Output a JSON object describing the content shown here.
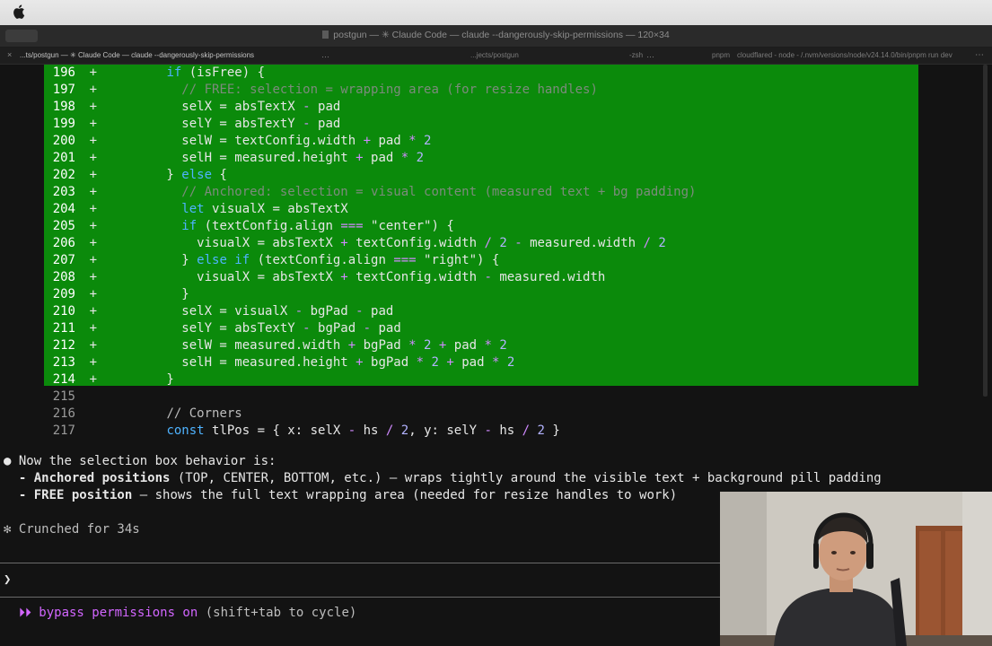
{
  "window": {
    "title": "postgun — ✳ Claude Code — claude --dangerously-skip-permissions — 120×34",
    "button_label": "⌘"
  },
  "tabs": [
    {
      "label": "...ts/postgun — ✳ Claude Code — claude --dangerously-skip-permissions"
    },
    {
      "label": "...jects/postgun"
    },
    {
      "label": "-zsh"
    },
    {
      "label": "pnpm"
    },
    {
      "label": "cloudflared - node - /.nvm/versions/node/v24.14.0/bin/pnpm run dev"
    }
  ],
  "diff": [
    {
      "num": "196",
      "marker": "+",
      "segs": [
        [
          "        ",
          ""
        ],
        [
          "if",
          "k"
        ],
        [
          " (isFree) {",
          ""
        ]
      ]
    },
    {
      "num": "197",
      "marker": "+",
      "segs": [
        [
          "          ",
          ""
        ],
        [
          "// FREE: selection = wrapping area (for resize handles)",
          "c"
        ]
      ]
    },
    {
      "num": "198",
      "marker": "+",
      "segs": [
        [
          "          selX = absTextX ",
          ""
        ],
        [
          "-",
          "o"
        ],
        [
          " pad",
          ""
        ]
      ]
    },
    {
      "num": "199",
      "marker": "+",
      "segs": [
        [
          "          selY = absTextY ",
          ""
        ],
        [
          "-",
          "o"
        ],
        [
          " pad",
          ""
        ]
      ]
    },
    {
      "num": "200",
      "marker": "+",
      "segs": [
        [
          "          selW = textConfig.width ",
          ""
        ],
        [
          "+",
          "o"
        ],
        [
          " pad ",
          ""
        ],
        [
          "*",
          "o"
        ],
        [
          " ",
          ""
        ],
        [
          "2",
          "n"
        ]
      ]
    },
    {
      "num": "201",
      "marker": "+",
      "segs": [
        [
          "          selH = measured.height ",
          ""
        ],
        [
          "+",
          "o"
        ],
        [
          " pad ",
          ""
        ],
        [
          "*",
          "o"
        ],
        [
          " ",
          ""
        ],
        [
          "2",
          "n"
        ]
      ]
    },
    {
      "num": "202",
      "marker": "+",
      "segs": [
        [
          "        } ",
          ""
        ],
        [
          "else",
          "k"
        ],
        [
          " {",
          ""
        ]
      ]
    },
    {
      "num": "203",
      "marker": "+",
      "segs": [
        [
          "          ",
          ""
        ],
        [
          "// Anchored: selection = visual content (measured text + bg padding)",
          "c"
        ]
      ]
    },
    {
      "num": "204",
      "marker": "+",
      "segs": [
        [
          "          ",
          ""
        ],
        [
          "let",
          "k"
        ],
        [
          " visualX = absTextX",
          ""
        ]
      ]
    },
    {
      "num": "205",
      "marker": "+",
      "segs": [
        [
          "          ",
          ""
        ],
        [
          "if",
          "k"
        ],
        [
          " (textConfig.align ",
          ""
        ],
        [
          "===",
          "o"
        ],
        [
          " \"center\") {",
          ""
        ]
      ]
    },
    {
      "num": "206",
      "marker": "+",
      "segs": [
        [
          "            visualX = absTextX ",
          ""
        ],
        [
          "+",
          "o"
        ],
        [
          " textConfig.width ",
          ""
        ],
        [
          "/",
          "o"
        ],
        [
          " ",
          ""
        ],
        [
          "2",
          "n"
        ],
        [
          " ",
          ""
        ],
        [
          "-",
          "o"
        ],
        [
          " measured.width ",
          ""
        ],
        [
          "/",
          "o"
        ],
        [
          " ",
          ""
        ],
        [
          "2",
          "n"
        ]
      ]
    },
    {
      "num": "207",
      "marker": "+",
      "segs": [
        [
          "          } ",
          ""
        ],
        [
          "else if",
          "k"
        ],
        [
          " (textConfig.align ",
          ""
        ],
        [
          "===",
          "o"
        ],
        [
          " \"right\") {",
          ""
        ]
      ]
    },
    {
      "num": "208",
      "marker": "+",
      "segs": [
        [
          "            visualX = absTextX ",
          ""
        ],
        [
          "+",
          "o"
        ],
        [
          " textConfig.width ",
          ""
        ],
        [
          "-",
          "o"
        ],
        [
          " measured.width",
          ""
        ]
      ]
    },
    {
      "num": "209",
      "marker": "+",
      "segs": [
        [
          "          }",
          ""
        ]
      ]
    },
    {
      "num": "210",
      "marker": "+",
      "segs": [
        [
          "          selX = visualX ",
          ""
        ],
        [
          "-",
          "o"
        ],
        [
          " bgPad ",
          ""
        ],
        [
          "-",
          "o"
        ],
        [
          " pad",
          ""
        ]
      ]
    },
    {
      "num": "211",
      "marker": "+",
      "segs": [
        [
          "          selY = absTextY ",
          ""
        ],
        [
          "-",
          "o"
        ],
        [
          " bgPad ",
          ""
        ],
        [
          "-",
          "o"
        ],
        [
          " pad",
          ""
        ]
      ]
    },
    {
      "num": "212",
      "marker": "+",
      "segs": [
        [
          "          selW = measured.width ",
          ""
        ],
        [
          "+",
          "o"
        ],
        [
          " bgPad ",
          ""
        ],
        [
          "*",
          "o"
        ],
        [
          " ",
          ""
        ],
        [
          "2",
          "n"
        ],
        [
          " ",
          ""
        ],
        [
          "+",
          "o"
        ],
        [
          " pad ",
          ""
        ],
        [
          "*",
          "o"
        ],
        [
          " ",
          ""
        ],
        [
          "2",
          "n"
        ]
      ]
    },
    {
      "num": "213",
      "marker": "+",
      "segs": [
        [
          "          selH = measured.height ",
          ""
        ],
        [
          "+",
          "o"
        ],
        [
          " bgPad ",
          ""
        ],
        [
          "*",
          "o"
        ],
        [
          " ",
          ""
        ],
        [
          "2",
          "n"
        ],
        [
          " ",
          ""
        ],
        [
          "+",
          "o"
        ],
        [
          " pad ",
          ""
        ],
        [
          "*",
          "o"
        ],
        [
          " ",
          ""
        ],
        [
          "2",
          "n"
        ]
      ]
    },
    {
      "num": "214",
      "marker": "+",
      "segs": [
        [
          "        }",
          ""
        ]
      ]
    },
    {
      "num": "215",
      "marker": " ",
      "segs": []
    },
    {
      "num": "216",
      "marker": " ",
      "segs": [
        [
          "        ",
          ""
        ],
        [
          "// Corners",
          "gray"
        ]
      ]
    },
    {
      "num": "217",
      "marker": " ",
      "segs": [
        [
          "        ",
          ""
        ],
        [
          "const",
          "k"
        ],
        [
          " tlPos = { x: selX ",
          ""
        ],
        [
          "-",
          "o"
        ],
        [
          " hs ",
          ""
        ],
        [
          "/",
          "o"
        ],
        [
          " ",
          ""
        ],
        [
          "2",
          "n"
        ],
        [
          ", y: selY ",
          ""
        ],
        [
          "-",
          "o"
        ],
        [
          " hs ",
          ""
        ],
        [
          "/",
          "o"
        ],
        [
          " ",
          ""
        ],
        [
          "2",
          "n"
        ],
        [
          " }",
          ""
        ]
      ]
    }
  ],
  "summary": {
    "bullet": "●",
    "intro": " Now the selection box behavior is:",
    "item1_bold": "  - Anchored positions",
    "item1_rest": " (TOP, CENTER, BOTTOM, etc.) — wraps tightly around the visible text + background pill padding",
    "item2_bold": "  - FREE position",
    "item2_rest": " — shows the full text wrapping area (needed for resize handles to work)"
  },
  "status": {
    "crunch": "✻ Crunched for 34s"
  },
  "prompt": {
    "symbol": "❯",
    "value": ""
  },
  "footer": {
    "arrows": "  ⏵⏵",
    "mode": " bypass permissions on",
    "hint": " (shift+tab to cycle)"
  },
  "colors": {
    "added_bg": "#0b8a0b",
    "keyword": "#4fb3ff",
    "comment": "#7c8b7c",
    "number": "#b3b3ff",
    "operator": "#d08aff",
    "footer_accent": "#d266ff"
  }
}
